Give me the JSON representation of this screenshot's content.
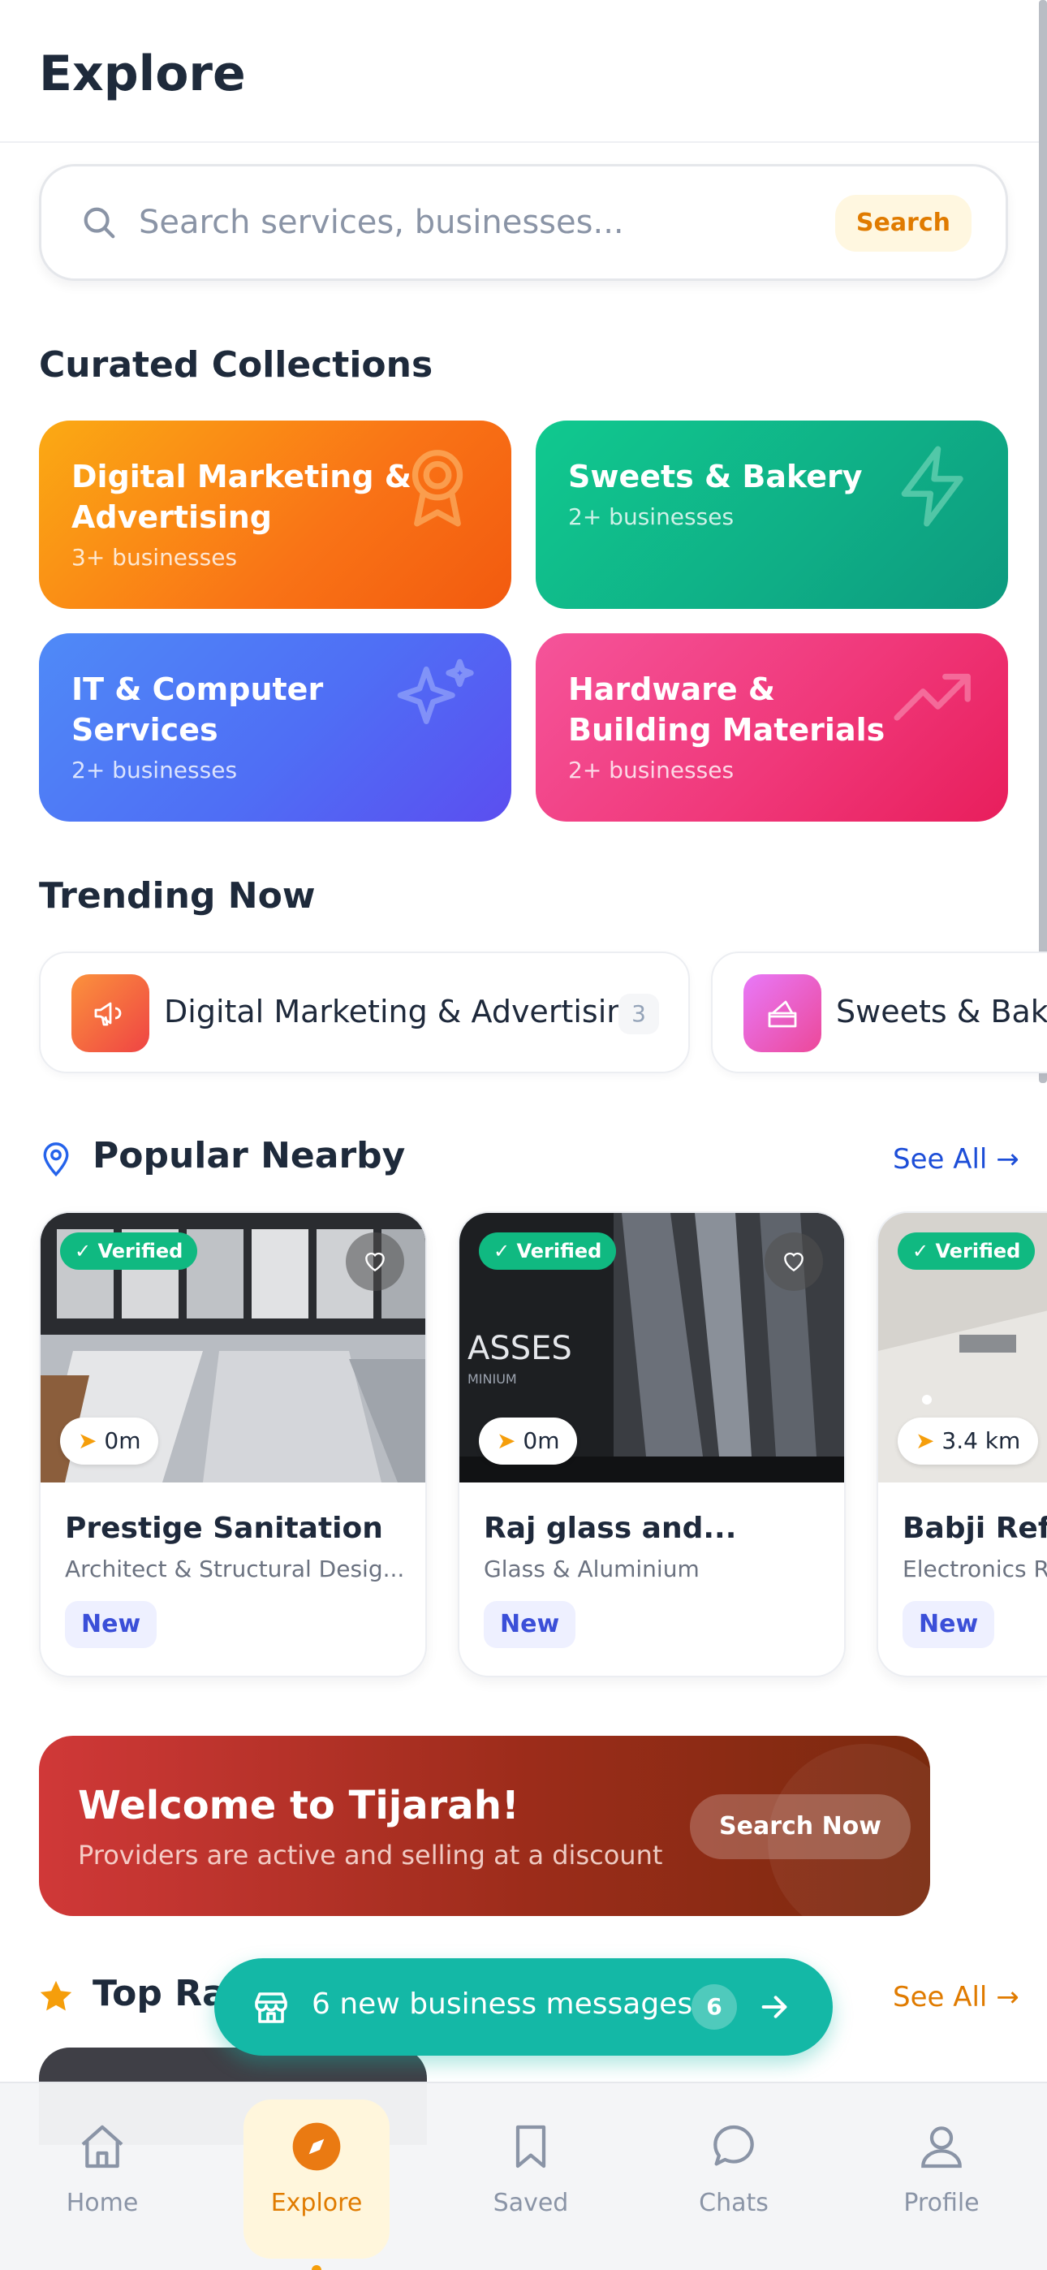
{
  "header": {
    "title": "Explore"
  },
  "search": {
    "placeholder": "Search services, businesses...",
    "value": "",
    "button_label": "Search"
  },
  "collections": {
    "title": "Curated Collections",
    "items": [
      {
        "title": "Digital Marketing & Advertising",
        "subtitle": "3+ businesses",
        "icon": "award-icon"
      },
      {
        "title": "Sweets & Bakery",
        "subtitle": "2+ businesses",
        "icon": "lightning-icon"
      },
      {
        "title": "IT & Computer Services",
        "subtitle": "2+ businesses",
        "icon": "sparkles-icon"
      },
      {
        "title": "Hardware & Building Materials",
        "subtitle": "2+ businesses",
        "icon": "trending-up-icon"
      }
    ]
  },
  "trending": {
    "title": "Trending Now",
    "items": [
      {
        "label": "Digital Marketing & Advertising",
        "count": "3",
        "icon": "megaphone-icon"
      },
      {
        "label": "Sweets & Bakery",
        "icon": "cake-icon"
      }
    ]
  },
  "popular": {
    "title": "Popular Nearby",
    "see_all": "See All",
    "items": [
      {
        "name": "Prestige Sanitation",
        "category": "Architect & Structural Desig...",
        "distance": "0m",
        "verified": "Verified",
        "badge": "New"
      },
      {
        "name": "Raj glass and...",
        "category": "Glass & Aluminium",
        "distance": "0m",
        "verified": "Verified",
        "badge": "New"
      },
      {
        "name": "Babji Refri",
        "category": "Electronics R",
        "distance": "3.4 km",
        "verified": "Verified",
        "badge": "New"
      }
    ]
  },
  "promo": {
    "title": "Welcome to Tijarah!",
    "subtitle": "Providers are active and selling at a discount",
    "button_label": "Search Now"
  },
  "top_rated": {
    "title": "Top Ra",
    "see_all": "See All"
  },
  "toast": {
    "text": "6 new business messages",
    "count": "6"
  },
  "tabbar": {
    "items": [
      {
        "label": "Home",
        "icon": "home-icon"
      },
      {
        "label": "Explore",
        "icon": "compass-icon"
      },
      {
        "label": "Saved",
        "icon": "bookmark-icon"
      },
      {
        "label": "Chats",
        "icon": "chat-icon"
      },
      {
        "label": "Profile",
        "icon": "user-icon"
      }
    ],
    "active": "Explore"
  },
  "colors": {
    "accent": "#e07b00",
    "teal": "#14b8a6",
    "verified": "#10b981",
    "link": "#1d4ed8"
  }
}
